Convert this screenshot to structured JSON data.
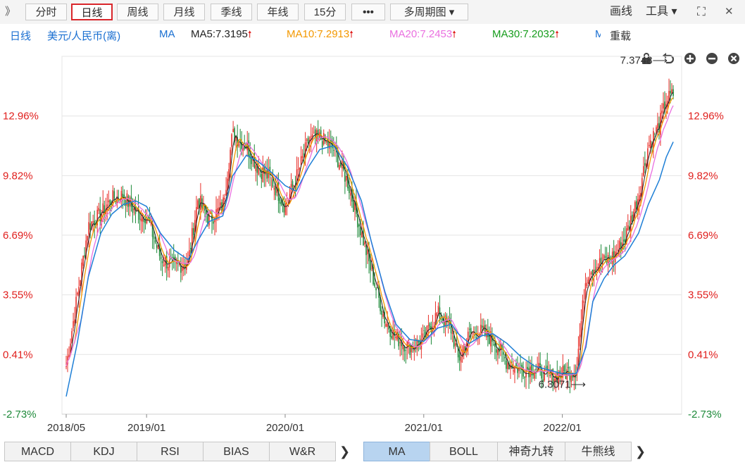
{
  "toolbar": {
    "collapse_icon": "double-chevron-right-icon",
    "collapse_glyph": "》",
    "buttons": [
      "分时",
      "日线",
      "周线",
      "月线",
      "季线",
      "年线",
      "15分",
      "•••",
      "多周期图 ▾"
    ],
    "active_index": 1,
    "draw_label": "画线",
    "tools_label": "工具 ▾",
    "fullscreen_icon": "fullscreen-icon",
    "fullscreen_glyph": "⛶",
    "close_icon": "close-icon",
    "close_glyph": "✕"
  },
  "infobar": {
    "period": "日线",
    "symbol": "美元/人民币(离)",
    "indicator": "MA",
    "ma5": "MA5:7.3195",
    "ma10": "MA10:7.2913",
    "ma20": "MA20:7.2453",
    "ma30": "MA30:7.2032",
    "truncated": "M",
    "up_glyph": "🠕",
    "reload_label": "重载",
    "lock_icon": "lock-icon",
    "undo_icon": "undo-icon",
    "zoom_in_icon": "zoom-in-icon",
    "zoom_out_icon": "zoom-out-icon",
    "colors": {
      "ma": "#1e7fd6",
      "ma5": "#222222",
      "ma10": "#f39800",
      "ma20": "#ea6fe0",
      "ma30": "#169c1c",
      "blue": "#1a6fd1"
    }
  },
  "chart_data": {
    "type": "candlestick",
    "y_tick_labels": [
      "12.96%",
      "9.82%",
      "6.69%",
      "3.55%",
      "0.41%",
      "-2.73%"
    ],
    "y_tick_values": [
      12.96,
      9.82,
      6.69,
      3.55,
      0.41,
      -2.73
    ],
    "ylim": [
      -2.73,
      16.1
    ],
    "x_tick_labels": [
      "2018/05",
      "2019/01",
      "2020/01",
      "2021/01",
      "2022/01"
    ],
    "x_tick_values": [
      2018.42,
      2019.0,
      2020.0,
      2021.0,
      2022.0
    ],
    "xlim": [
      2018.42,
      2022.82
    ],
    "annotations": [
      {
        "text": "7.3748⟶",
        "x": 2022.8,
        "y": 15.9
      },
      {
        "text": "6.3071⟶",
        "x": 2022.18,
        "y": -1.15
      }
    ],
    "price_series": {
      "x": [
        2018.42,
        2018.5,
        2018.58,
        2018.67,
        2018.75,
        2018.83,
        2018.92,
        2019.0,
        2019.1,
        2019.2,
        2019.3,
        2019.37,
        2019.45,
        2019.55,
        2019.62,
        2019.72,
        2019.8,
        2019.9,
        2020.0,
        2020.08,
        2020.17,
        2020.25,
        2020.35,
        2020.45,
        2020.55,
        2020.62,
        2020.72,
        2020.8,
        2020.9,
        2021.0,
        2021.1,
        2021.2,
        2021.25,
        2021.33,
        2021.42,
        2021.5,
        2021.6,
        2021.7,
        2021.8,
        2021.9,
        2022.0,
        2022.1,
        2022.17,
        2022.22,
        2022.3,
        2022.37,
        2022.45,
        2022.55,
        2022.62,
        2022.7,
        2022.75,
        2022.8
      ],
      "values": [
        -0.2,
        3.5,
        7.2,
        7.8,
        8.6,
        8.8,
        7.9,
        7.7,
        5.5,
        5.0,
        5.3,
        8.6,
        7.5,
        8.2,
        12.0,
        11.4,
        10.3,
        9.6,
        8.2,
        9.7,
        11.7,
        11.8,
        11.2,
        9.5,
        6.8,
        4.8,
        2.2,
        1.3,
        0.8,
        1.2,
        2.6,
        1.7,
        0.1,
        1.5,
        1.6,
        1.2,
        0.0,
        -0.4,
        -0.3,
        -0.8,
        -0.6,
        -0.4,
        4.5,
        5.0,
        5.3,
        5.6,
        6.5,
        8.8,
        11.4,
        12.5,
        13.8,
        14.1
      ],
      "ma30_values": [
        -1.8,
        1.0,
        4.5,
        6.8,
        7.8,
        8.3,
        8.5,
        8.2,
        6.8,
        5.9,
        5.4,
        6.4,
        7.4,
        7.7,
        9.8,
        10.9,
        10.6,
        10.0,
        9.3,
        9.0,
        10.3,
        11.2,
        11.4,
        10.3,
        8.5,
        6.4,
        3.7,
        2.0,
        1.2,
        1.1,
        1.8,
        2.0,
        1.5,
        1.0,
        1.4,
        1.5,
        1.0,
        0.3,
        -0.2,
        -0.4,
        -0.6,
        -0.6,
        0.8,
        3.2,
        4.4,
        5.1,
        5.6,
        6.8,
        8.3,
        9.6,
        10.8,
        11.6
      ]
    },
    "colors": {
      "up": "#e8302a",
      "down": "#1e8a3a",
      "ma5": "#222222",
      "ma10": "#f39800",
      "ma20": "#ea6fe0",
      "ma30": "#1e7fd6",
      "grid": "#e4e4e4",
      "axis_red": "#e0201e",
      "axis_green": "#1e8a3a"
    }
  },
  "bottom_tabs": {
    "left": [
      "MACD",
      "KDJ",
      "RSI",
      "BIAS",
      "W&R"
    ],
    "right": [
      "MA",
      "BOLL",
      "神奇九转",
      "牛熊线"
    ],
    "active": "MA",
    "more_glyph": "❯",
    "more_icon": "chevron-right-icon"
  }
}
